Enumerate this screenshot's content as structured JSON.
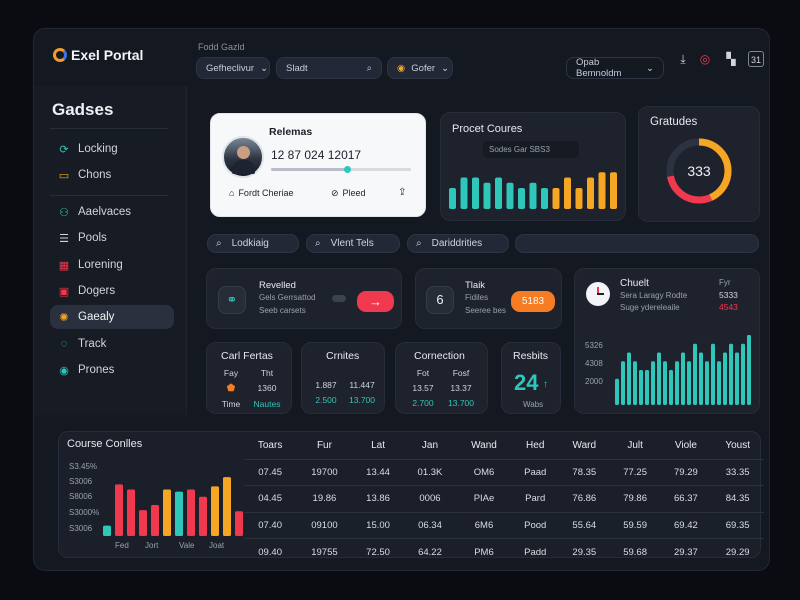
{
  "header": {
    "app_name": "Exel Portal",
    "caption": "Fodd Gazld",
    "filter_label": "Gefheclivur",
    "search_placeholder": "Sladt",
    "status_label": "Gofer",
    "account_label": "Opab Bemnoldm"
  },
  "sidebar": {
    "title": "Gadses",
    "items": [
      {
        "label": "Locking",
        "icon": "refresh-icon"
      },
      {
        "label": "Chons",
        "icon": "folder-icon"
      },
      {
        "label": "Aaelvaces",
        "icon": "users-icon"
      },
      {
        "label": "Pools",
        "icon": "list-icon"
      },
      {
        "label": "Lorening",
        "icon": "calendar-icon"
      },
      {
        "label": "Dogers",
        "icon": "document-icon"
      },
      {
        "label": "Gaealy",
        "icon": "gear-icon"
      },
      {
        "label": "Track",
        "icon": "chat-icon"
      },
      {
        "label": "Prones",
        "icon": "eye-icon"
      }
    ]
  },
  "profile": {
    "title": "Relemas",
    "value": "12 87 024 12017",
    "action_left": "Fordt Cheriae",
    "action_right": "Pleed",
    "progress": 0.54
  },
  "product": {
    "title": "Procet Coures",
    "subtitle": "Sodes Gar SBS3"
  },
  "gauge": {
    "title": "Gratudes",
    "value": "333",
    "fraction": 0.72
  },
  "searches": [
    "Lodkiaig",
    "Vlent Tels",
    "Dariddrities"
  ],
  "actions": [
    {
      "title": "Revelled",
      "line1": "Gels Gerrsattod",
      "line2": "Seeb carsets",
      "button": "→"
    },
    {
      "title": "Tlaik",
      "line1": "Fidiles",
      "line2": "Seeree bes",
      "button": "5183",
      "badge": "6"
    }
  ],
  "chart_right": {
    "title": "Chuelt",
    "line1": "Sera Laragy Rodte",
    "line2": "Suge ydereleaile",
    "right_label": "Fyr",
    "right_value1": "5333",
    "right_value2": "4543",
    "tick_labels": [
      "5326",
      "4308",
      "2000"
    ]
  },
  "stats": [
    {
      "title": "Carl Fertas",
      "cols": [
        "Fay",
        "Tht"
      ],
      "rows": [
        [
          "",
          "1360"
        ],
        [
          "Time",
          "Nautes"
        ]
      ]
    },
    {
      "title": "Crnites",
      "cols": [
        "",
        ""
      ],
      "rows": [
        [
          "1.887",
          "11.447"
        ],
        [
          "2.500",
          "13.700"
        ]
      ]
    },
    {
      "title": "Cornection",
      "cols": [
        "Fot",
        "Fosf"
      ],
      "rows": [
        [
          "13.57",
          "13.37"
        ],
        [
          "2.700",
          "13.700"
        ]
      ]
    },
    {
      "title": "Resbits",
      "value": "24",
      "sub": "Wabs"
    }
  ],
  "course": {
    "title": "Course Conlles",
    "tick_labels": [
      "S3.45%",
      "S3006",
      "S8006",
      "S3000%",
      "S3006"
    ],
    "x_labels": [
      "Fed",
      "Jort",
      "Vale",
      "Joat"
    ]
  },
  "table": {
    "headers": [
      "Toars",
      "Fur",
      "Lat",
      "Jan",
      "Wand",
      "Hed",
      "Ward",
      "Jult",
      "Viole",
      "Youst"
    ],
    "rows": [
      [
        "07.45",
        "19700",
        "13.44",
        "01.3K",
        "OM6",
        "Paad",
        "78.35",
        "77.25",
        "79.29",
        "33.35"
      ],
      [
        "04.45",
        "19.86",
        "13.86",
        "0006",
        "PIAe",
        "Pard",
        "76.86",
        "79.86",
        "66.37",
        "84.35"
      ],
      [
        "07.40",
        "09100",
        "15.00",
        "06.34",
        "6M6",
        "Pood",
        "55.64",
        "59.59",
        "69.42",
        "69.35"
      ],
      [
        "09.40",
        "19755",
        "72.50",
        "64.22",
        "PM6",
        "Padd",
        "29.35",
        "59.68",
        "29.37",
        "29.29"
      ]
    ]
  },
  "chart_data": [
    {
      "type": "bar",
      "title": "Procet Coures",
      "values": [
        4,
        6,
        6,
        5,
        6,
        5,
        4,
        5,
        4,
        4,
        6,
        4,
        6,
        7,
        7
      ],
      "colors": [
        "#2ec7ba",
        "#2ec7ba",
        "#2ec7ba",
        "#2ec7ba",
        "#2ec7ba",
        "#2ec7ba",
        "#2ec7ba",
        "#2ec7ba",
        "#2ec7ba",
        "#f5a623",
        "#f5a623",
        "#f5a623",
        "#f5a623",
        "#f5a623",
        "#f5a623"
      ]
    },
    {
      "type": "bar",
      "title": "Chuelt",
      "values": [
        3,
        5,
        6,
        5,
        4,
        4,
        5,
        6,
        5,
        4,
        5,
        6,
        5,
        7,
        6,
        5,
        7,
        5,
        6,
        7,
        6,
        7,
        8
      ],
      "color": "#2ec7ba"
    },
    {
      "type": "bar",
      "title": "Course Conlles",
      "values": [
        1,
        5,
        4.5,
        2.5,
        3,
        4.5,
        4.3,
        4.5,
        3.8,
        4.8,
        5.7,
        2.4
      ],
      "colors": [
        "#2ec7ba",
        "#f0384e",
        "#f0384e",
        "#f0384e",
        "#f0384e",
        "#f5a623",
        "#2ec7ba",
        "#f0384e",
        "#f0384e",
        "#f5a623",
        "#f5a623",
        "#f0384e"
      ]
    }
  ],
  "colors": {
    "teal": "#2ec7ba",
    "orange": "#f5a623",
    "red": "#f0384e",
    "panel": "#1d222d"
  }
}
